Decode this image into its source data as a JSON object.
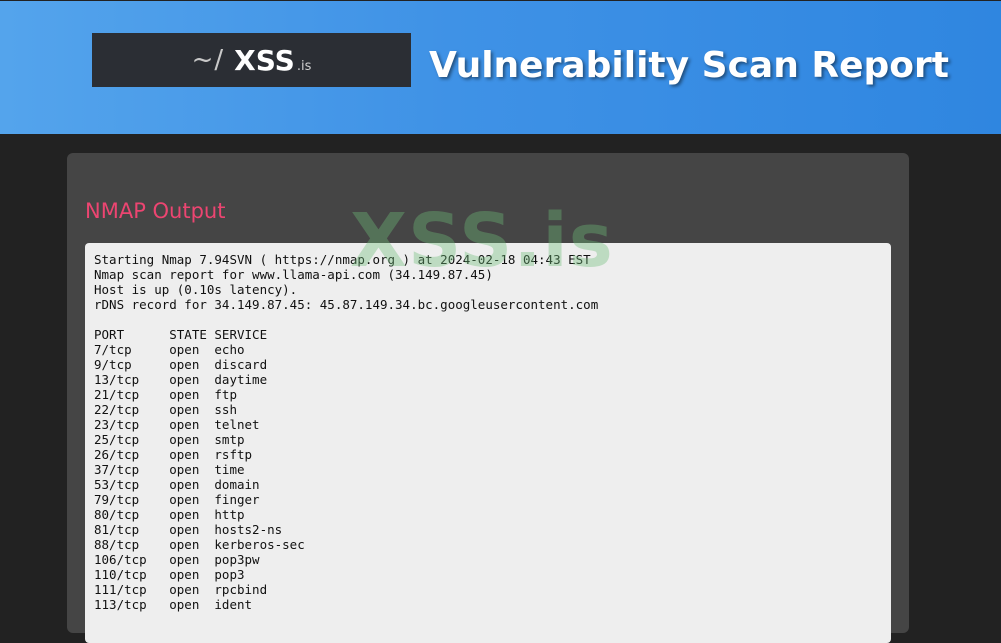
{
  "header": {
    "logo": {
      "prefix": "~/",
      "main": "XSS",
      "tld": ".is"
    },
    "title": "Vulnerability Scan Report"
  },
  "section": {
    "title": "NMAP Output"
  },
  "output": {
    "lines": [
      "Starting Nmap 7.94SVN ( https://nmap.org ) at 2024-02-18 04:43 EST",
      "Nmap scan report for www.llama-api.com (34.149.87.45)",
      "Host is up (0.10s latency).",
      "rDNS record for 34.149.87.45: 45.87.149.34.bc.googleusercontent.com",
      "",
      "PORT      STATE SERVICE",
      "7/tcp     open  echo",
      "9/tcp     open  discard",
      "13/tcp    open  daytime",
      "21/tcp    open  ftp",
      "22/tcp    open  ssh",
      "23/tcp    open  telnet",
      "25/tcp    open  smtp",
      "26/tcp    open  rsftp",
      "37/tcp    open  time",
      "53/tcp    open  domain",
      "79/tcp    open  finger",
      "80/tcp    open  http",
      "81/tcp    open  hosts2-ns",
      "88/tcp    open  kerberos-sec",
      "106/tcp   open  pop3pw",
      "110/tcp   open  pop3",
      "111/tcp   open  rpcbind",
      "113/tcp   open  ident"
    ]
  },
  "watermark": "XSS.is",
  "colors": {
    "header_start": "#54a4ec",
    "header_end": "#2f86e0",
    "background": "#222222",
    "panel": "#454545",
    "section_title": "#ec4571",
    "output_bg": "#eeeeee"
  }
}
